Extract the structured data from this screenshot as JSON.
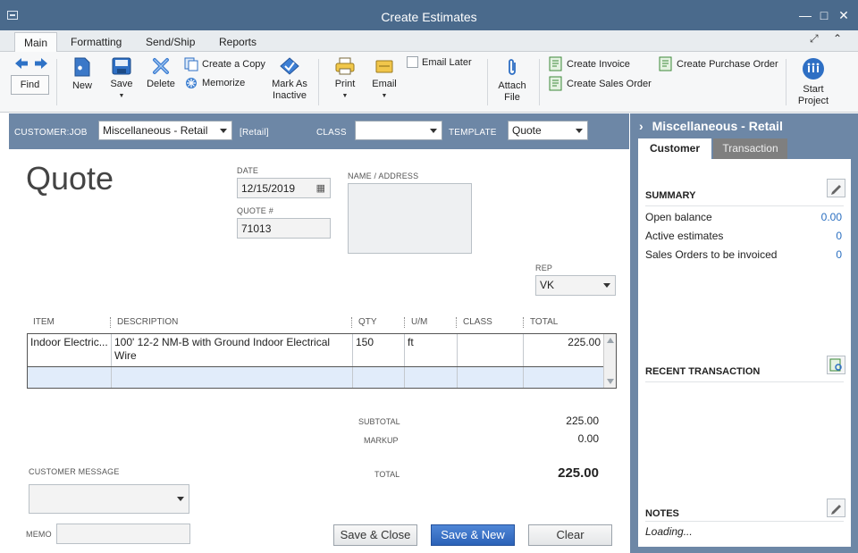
{
  "window": {
    "title": "Create Estimates"
  },
  "tabs": [
    "Main",
    "Formatting",
    "Send/Ship",
    "Reports"
  ],
  "toolbar": {
    "find": "Find",
    "new": "New",
    "save": "Save",
    "delete": "Delete",
    "create_copy": "Create a Copy",
    "memorize": "Memorize",
    "mark_inactive_1": "Mark As",
    "mark_inactive_2": "Inactive",
    "print": "Print",
    "email": "Email",
    "email_later": "Email Later",
    "attach_1": "Attach",
    "attach_2": "File",
    "create_invoice": "Create Invoice",
    "create_sales_order": "Create Sales Order",
    "create_po": "Create Purchase Order",
    "start_project_1": "Start",
    "start_project_2": "Project"
  },
  "header": {
    "customer_job_label": "CUSTOMER:JOB",
    "customer_job_value": "Miscellaneous - Retail",
    "retail_tag": "[Retail]",
    "class_label": "CLASS",
    "class_value": "",
    "template_label": "TEMPLATE",
    "template_value": "Quote"
  },
  "form": {
    "title": "Quote",
    "date_label": "DATE",
    "date_value": "12/15/2019",
    "quote_no_label": "QUOTE #",
    "quote_no_value": "71013",
    "name_address_label": "NAME / ADDRESS",
    "rep_label": "REP",
    "rep_value": "VK"
  },
  "table": {
    "headers": [
      "ITEM",
      "DESCRIPTION",
      "QTY",
      "U/M",
      "CLASS",
      "TOTAL"
    ],
    "rows": [
      {
        "item": "Indoor Electric...",
        "description": "100' 12-2 NM-B with Ground Indoor Electrical Wire",
        "qty": "150",
        "um": "ft",
        "class": "",
        "total": "225.00"
      }
    ]
  },
  "totals": {
    "subtotal_label": "SUBTOTAL",
    "subtotal_value": "225.00",
    "markup_label": "MARKUP",
    "markup_value": "0.00",
    "total_label": "TOTAL",
    "total_value": "225.00"
  },
  "footer": {
    "customer_message_label": "CUSTOMER MESSAGE",
    "memo_label": "MEMO",
    "save_close": "Save & Close",
    "save_new": "Save & New",
    "clear": "Clear"
  },
  "panel": {
    "title": "Miscellaneous - Retail",
    "tab_customer": "Customer",
    "tab_transaction": "Transaction",
    "summary_title": "SUMMARY",
    "summary": [
      {
        "label": "Open balance",
        "value": "0.00"
      },
      {
        "label": "Active estimates",
        "value": "0"
      },
      {
        "label": "Sales Orders to be invoiced",
        "value": "0"
      }
    ],
    "recent_title": "RECENT TRANSACTION",
    "notes_title": "NOTES",
    "notes_value": "Loading..."
  }
}
